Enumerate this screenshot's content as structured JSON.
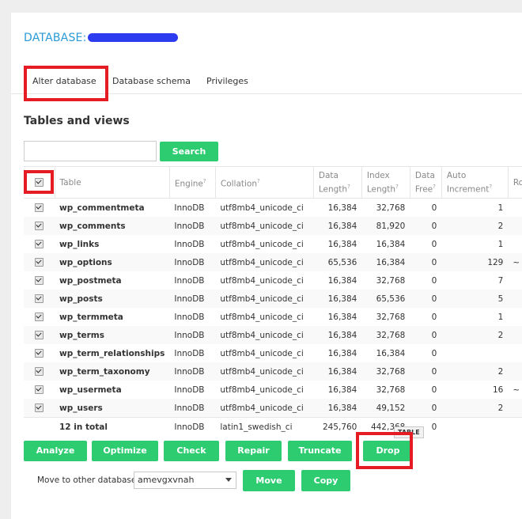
{
  "database": {
    "title_prefix": "DATABASE:",
    "title_suffix": ""
  },
  "tabs": [
    {
      "label": "Alter database"
    },
    {
      "label": "Database schema"
    },
    {
      "label": "Privileges"
    }
  ],
  "section_title": "Tables and views",
  "search": {
    "button_label": "Search",
    "value": ""
  },
  "columns": {
    "table": "Table",
    "engine": "Engine",
    "collation": "Collation",
    "data_length_1": "Data",
    "data_length_2": "Length",
    "index_length_1": "Index",
    "index_length_2": "Length",
    "data_free_1": "Data",
    "data_free_2": "Free",
    "auto_inc_1": "Auto",
    "auto_inc_2": "Increment",
    "rows": "Ro",
    "help_mark": "?"
  },
  "rows": [
    {
      "name": "wp_commentmeta",
      "engine": "InnoDB",
      "collation": "utf8mb4_unicode_ci",
      "data_length": "16,384",
      "index_length": "32,768",
      "data_free": "0",
      "auto_increment": "1",
      "extra": ""
    },
    {
      "name": "wp_comments",
      "engine": "InnoDB",
      "collation": "utf8mb4_unicode_ci",
      "data_length": "16,384",
      "index_length": "81,920",
      "data_free": "0",
      "auto_increment": "2",
      "extra": ""
    },
    {
      "name": "wp_links",
      "engine": "InnoDB",
      "collation": "utf8mb4_unicode_ci",
      "data_length": "16,384",
      "index_length": "16,384",
      "data_free": "0",
      "auto_increment": "1",
      "extra": ""
    },
    {
      "name": "wp_options",
      "engine": "InnoDB",
      "collation": "utf8mb4_unicode_ci",
      "data_length": "65,536",
      "index_length": "16,384",
      "data_free": "0",
      "auto_increment": "129",
      "extra": "~"
    },
    {
      "name": "wp_postmeta",
      "engine": "InnoDB",
      "collation": "utf8mb4_unicode_ci",
      "data_length": "16,384",
      "index_length": "32,768",
      "data_free": "0",
      "auto_increment": "7",
      "extra": ""
    },
    {
      "name": "wp_posts",
      "engine": "InnoDB",
      "collation": "utf8mb4_unicode_ci",
      "data_length": "16,384",
      "index_length": "65,536",
      "data_free": "0",
      "auto_increment": "5",
      "extra": ""
    },
    {
      "name": "wp_termmeta",
      "engine": "InnoDB",
      "collation": "utf8mb4_unicode_ci",
      "data_length": "16,384",
      "index_length": "32,768",
      "data_free": "0",
      "auto_increment": "1",
      "extra": ""
    },
    {
      "name": "wp_terms",
      "engine": "InnoDB",
      "collation": "utf8mb4_unicode_ci",
      "data_length": "16,384",
      "index_length": "32,768",
      "data_free": "0",
      "auto_increment": "2",
      "extra": ""
    },
    {
      "name": "wp_term_relationships",
      "engine": "InnoDB",
      "collation": "utf8mb4_unicode_ci",
      "data_length": "16,384",
      "index_length": "16,384",
      "data_free": "0",
      "auto_increment": "",
      "extra": ""
    },
    {
      "name": "wp_term_taxonomy",
      "engine": "InnoDB",
      "collation": "utf8mb4_unicode_ci",
      "data_length": "16,384",
      "index_length": "32,768",
      "data_free": "0",
      "auto_increment": "2",
      "extra": ""
    },
    {
      "name": "wp_usermeta",
      "engine": "InnoDB",
      "collation": "utf8mb4_unicode_ci",
      "data_length": "16,384",
      "index_length": "32,768",
      "data_free": "0",
      "auto_increment": "16",
      "extra": "~"
    },
    {
      "name": "wp_users",
      "engine": "InnoDB",
      "collation": "utf8mb4_unicode_ci",
      "data_length": "16,384",
      "index_length": "49,152",
      "data_free": "0",
      "auto_increment": "2",
      "extra": ""
    }
  ],
  "total": {
    "label": "12 in total",
    "engine": "InnoDB",
    "collation": "latin1_swedish_ci",
    "data_length": "245,760",
    "index_length": "442,368",
    "data_free": "0"
  },
  "actions": {
    "analyze": "Analyze",
    "optimize": "Optimize",
    "check": "Check",
    "repair": "Repair",
    "truncate": "Truncate",
    "drop": "Drop",
    "drop_tooltip": "TABLE"
  },
  "move": {
    "label": "Move to other database:",
    "selected": "amevgxvnah",
    "move_button": "Move",
    "copy_button": "Copy"
  },
  "colors": {
    "accent": "#2ecc71",
    "title": "#2a9bd6",
    "highlight": "#e51c23"
  }
}
